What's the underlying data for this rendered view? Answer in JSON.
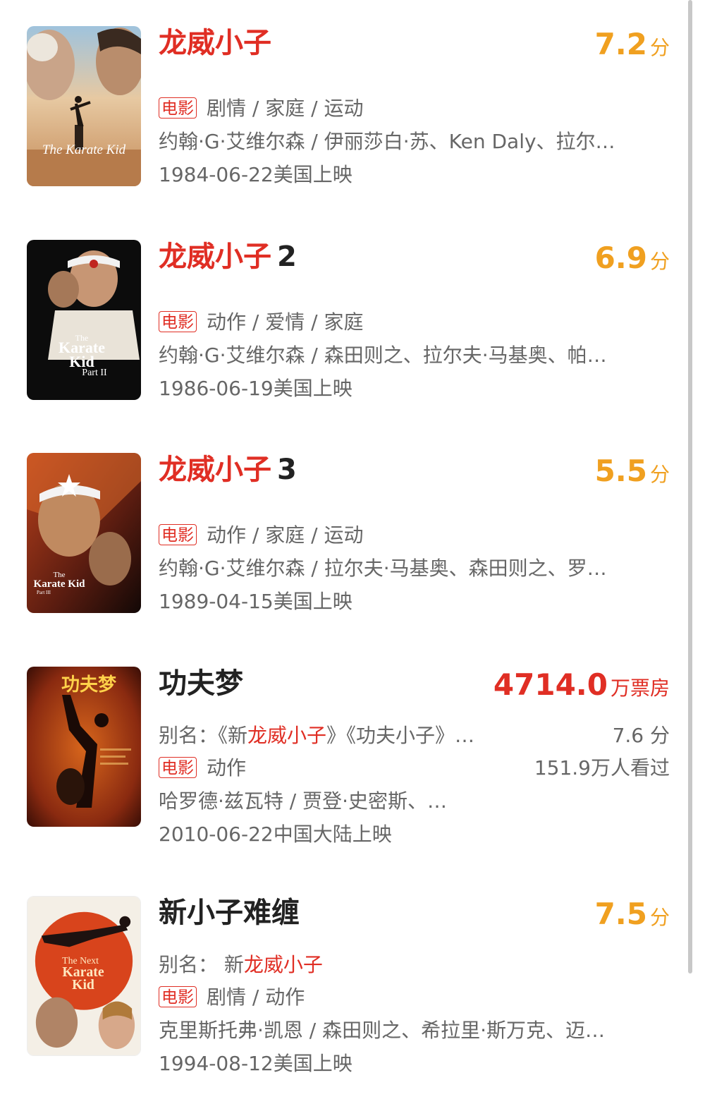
{
  "movies": [
    {
      "title": "龙威小子",
      "title_num": "",
      "score": "7.2",
      "score_unit": "分",
      "badge": "电影",
      "genres": "剧情 / 家庭 / 运动",
      "people": "约翰·G·艾维尔森 / 伊丽莎白·苏、Ken Daly、拉尔…",
      "release": "1984-06-22美国上映",
      "poster_text": "The Karate Kid"
    },
    {
      "title": "龙威小子",
      "title_num": "2",
      "score": "6.9",
      "score_unit": "分",
      "badge": "电影",
      "genres": "动作 / 爱情 / 家庭",
      "people": "约翰·G·艾维尔森 / 森田则之、拉尔夫·马基奥、帕…",
      "release": "1986-06-19美国上映",
      "poster_text": "The Karate Kid Part II"
    },
    {
      "title": "龙威小子",
      "title_num": "3",
      "score": "5.5",
      "score_unit": "分",
      "badge": "电影",
      "genres": "动作 / 家庭 / 运动",
      "people": "约翰·G·艾维尔森 / 拉尔夫·马基奥、森田则之、罗…",
      "release": "1989-04-15美国上映",
      "poster_text": "The Karate Kid Part III"
    },
    {
      "title": "功夫梦",
      "box_office": "4714.0",
      "box_office_unit": "万票房",
      "alias_prefix": "别名：《新",
      "alias_highlight": "龙威小子",
      "alias_suffix": "》《功夫小子》…",
      "score_text": "7.6 分",
      "badge": "电影",
      "genres": "动作",
      "viewers": "151.9万人看过",
      "people": "哈罗德·兹瓦特 / 贾登·史密斯、…",
      "release": "2010-06-22中国大陆上映",
      "poster_text": "功夫梦"
    },
    {
      "title": "新小子难缠",
      "score": "7.5",
      "score_unit": "分",
      "alias_prefix": "别名：  新",
      "alias_highlight": "龙威小子",
      "badge": "电影",
      "genres": "剧情 / 动作",
      "people": "克里斯托弗·凯恩 / 森田则之、希拉里·斯万克、迈…",
      "release": "1994-08-12美国上映",
      "poster_text": "The Next Karate Kid"
    }
  ]
}
